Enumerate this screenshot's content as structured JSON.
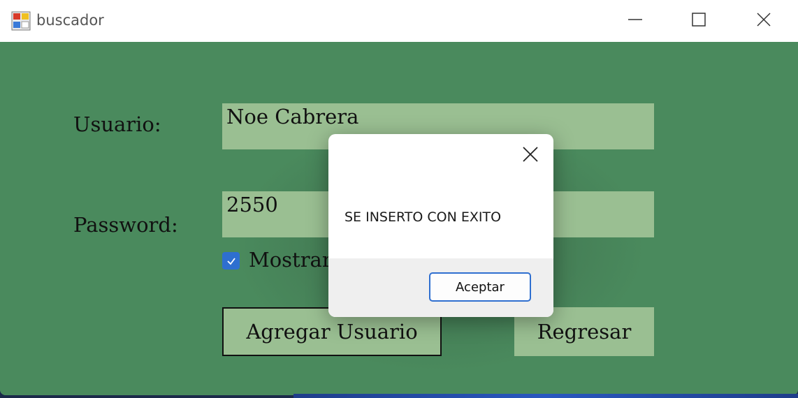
{
  "window": {
    "title": "buscador",
    "icon": "app-form-icon",
    "controls": [
      "minimize-icon",
      "maximize-icon",
      "close-icon"
    ]
  },
  "form": {
    "usuario_label": "Usuario:",
    "usuario_value": "Noe Cabrera",
    "password_label": "Password:",
    "password_value": "2550",
    "show_checkbox_label": "Mostrar",
    "show_checkbox_checked": true,
    "add_button": "Agregar Usuario",
    "back_button": "Regresar"
  },
  "dialog": {
    "message": "SE INSERTO CON EXITO",
    "ok_button": "Aceptar"
  },
  "colors": {
    "form_background": "#4a8a5d",
    "field_background": "#9abf92",
    "checkbox_accent": "#2e6fd0"
  }
}
